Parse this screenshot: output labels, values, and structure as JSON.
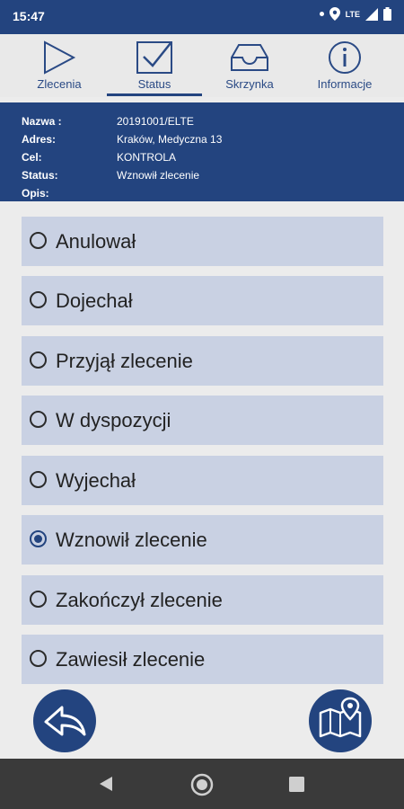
{
  "statusbar": {
    "time": "15:47",
    "network": "LTE"
  },
  "tabs": [
    {
      "label": "Zlecenia",
      "icon": "play-icon"
    },
    {
      "label": "Status",
      "icon": "checkbox-icon",
      "active": true
    },
    {
      "label": "Skrzynka",
      "icon": "inbox-icon"
    },
    {
      "label": "Informacje",
      "icon": "info-icon"
    }
  ],
  "info": {
    "nazwa_label": "Nazwa :",
    "nazwa": "20191001/ELTE",
    "adres_label": "Adres:",
    "adres": "Kraków, Medyczna 13",
    "cel_label": "Cel:",
    "cel": "KONTROLA",
    "status_label": "Status:",
    "status": "Wznowił zlecenie",
    "opis_label": "Opis:",
    "opis": ""
  },
  "options": [
    {
      "label": "Anulował",
      "checked": false
    },
    {
      "label": "Dojechał",
      "checked": false
    },
    {
      "label": "Przyjął zlecenie",
      "checked": false
    },
    {
      "label": "W dyspozycji",
      "checked": false
    },
    {
      "label": "Wyjechał",
      "checked": false
    },
    {
      "label": "Wznowił zlecenie",
      "checked": true
    },
    {
      "label": "Zakończył zlecenie",
      "checked": false
    },
    {
      "label": "Zawiesił zlecenie",
      "checked": false
    }
  ],
  "colors": {
    "primary": "#23447f",
    "option_bg": "#c9d1e3",
    "tab_text": "#2a4a85"
  }
}
